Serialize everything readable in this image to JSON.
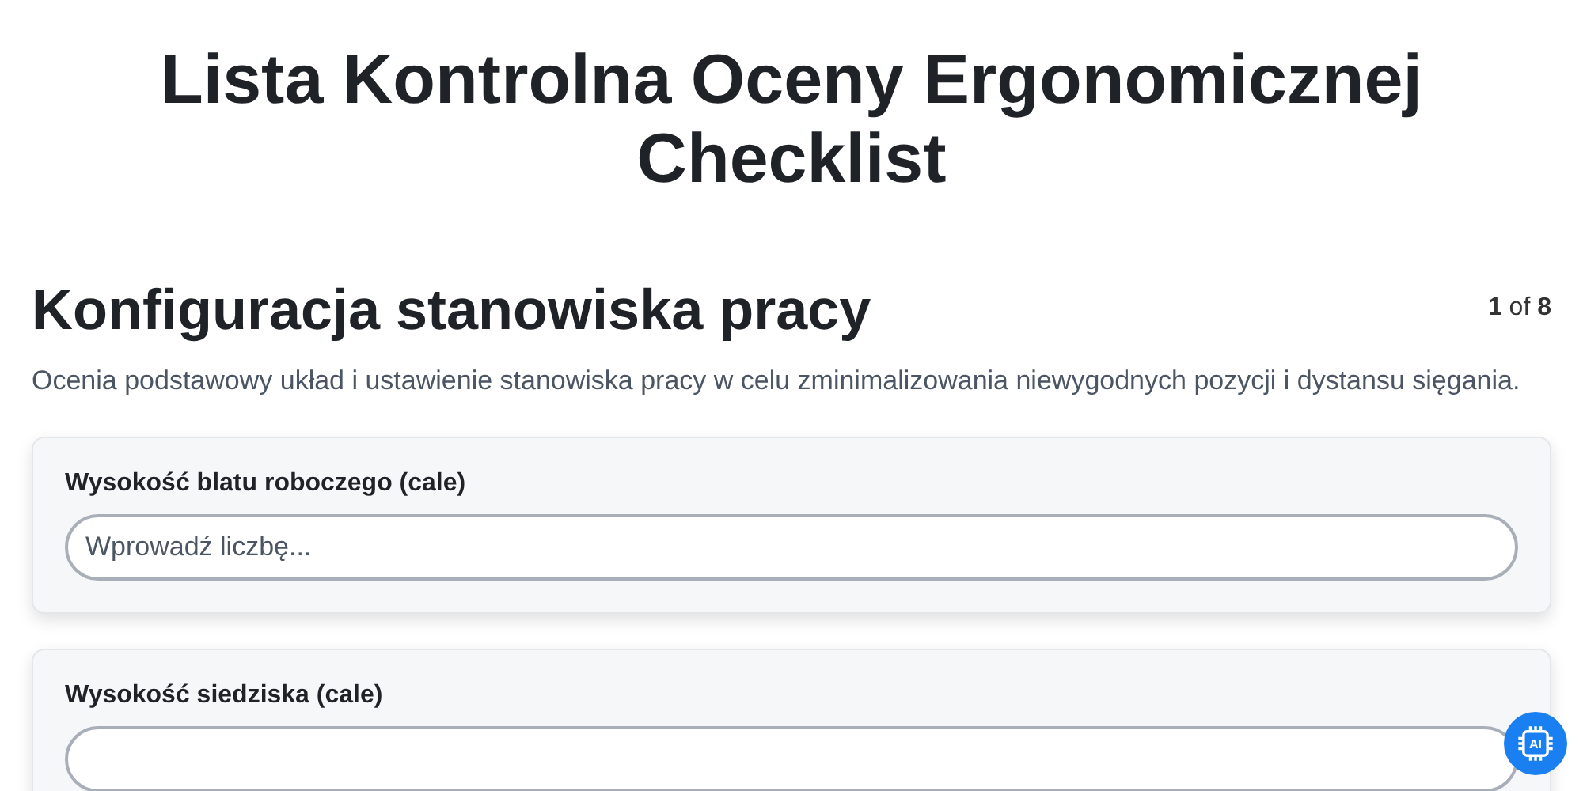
{
  "title": "Lista Kontrolna Oceny Ergonomicznej Checklist",
  "section": {
    "heading": "Konfiguracja stanowiska pracy",
    "progress": "**1** of **8**",
    "description": "Ocenia podstawowy układ i ustawienie stanowiska pracy w celu zminimalizowania niewygodnych pozycji i dystansu sięgania."
  },
  "questions": [
    {
      "label": "Wysokość blatu roboczego (cale)",
      "placeholder": "Wprowadź liczbę..."
    },
    {
      "label": "Wysokość siedziska (cale)"
    }
  ],
  "assistant_badge": "AI"
}
